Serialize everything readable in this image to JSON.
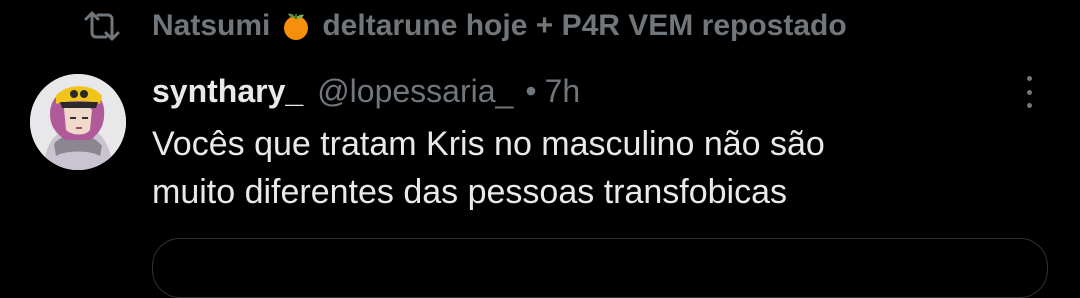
{
  "repost": {
    "icon": "repost-icon",
    "user_name": "Natsumi",
    "emoji": "🍊",
    "user_suffix": "deltarune hoje + P4R VEM",
    "action_label": "repostado"
  },
  "post": {
    "avatar_icon": "avatar-image",
    "display_name": "synthary_",
    "handle": "@lopessaria_",
    "separator": "•",
    "time": "7h",
    "text_lines": [
      "Vocês que tratam Kris no masculino não são",
      "muito diferentes das pessoas transfobicas"
    ],
    "more_icon": "more-vertical-icon"
  },
  "colors": {
    "background": "#000000",
    "primary_text": "#e7e9ea",
    "secondary_text": "#71767b",
    "border": "#2f3336"
  }
}
